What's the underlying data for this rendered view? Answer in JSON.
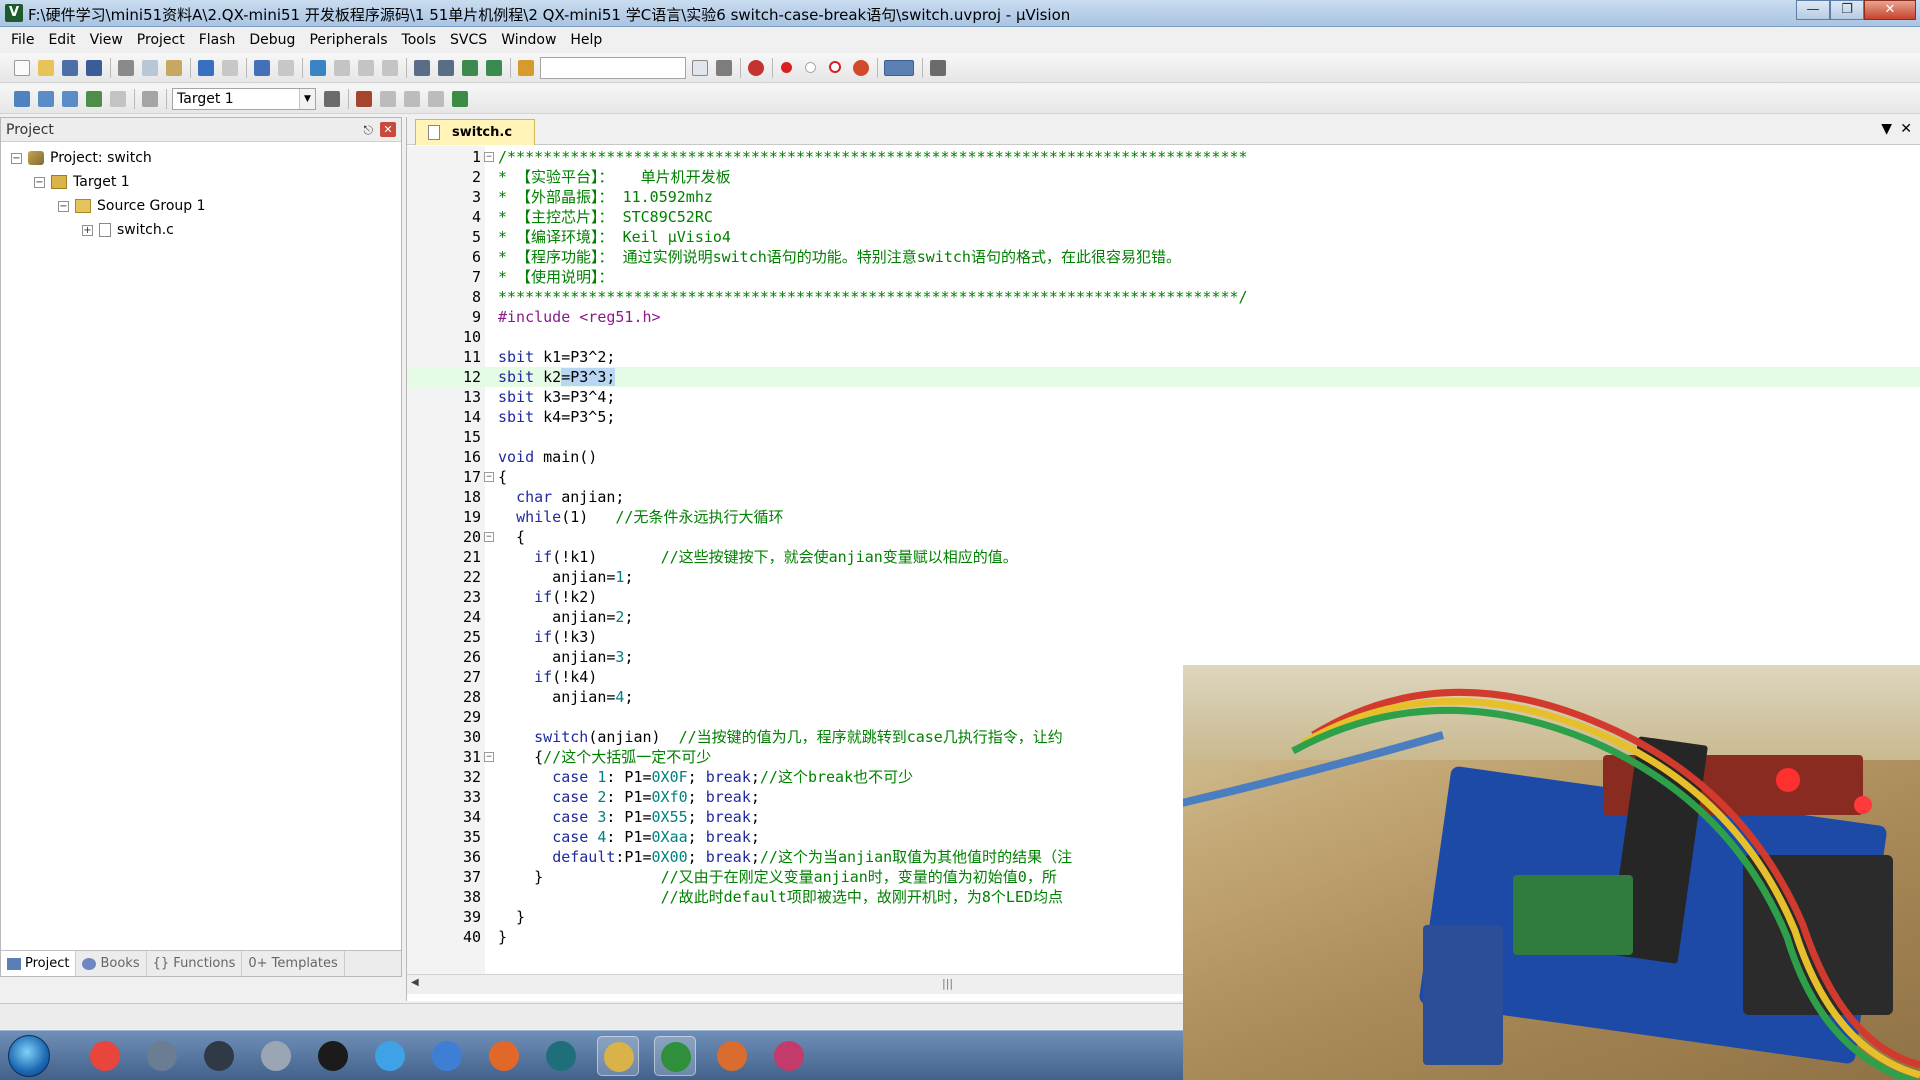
{
  "window": {
    "title": "F:\\硬件学习\\mini51资料A\\2.QX-mini51 开发板程序源码\\1 51单片机例程\\2 QX-mini51 学C语言\\实验6 switch-case-break语句\\switch.uvproj - µVision",
    "app_icon": "V"
  },
  "menu": [
    "File",
    "Edit",
    "View",
    "Project",
    "Flash",
    "Debug",
    "Peripherals",
    "Tools",
    "SVCS",
    "Window",
    "Help"
  ],
  "toolbar": {
    "target_select": "Target 1",
    "find_combo": ""
  },
  "project_panel": {
    "title": "Project",
    "tree": [
      {
        "label": "Project: switch",
        "toggle": "−"
      },
      {
        "label": "Target 1",
        "toggle": "−"
      },
      {
        "label": "Source Group 1",
        "toggle": "−"
      },
      {
        "label": "switch.c",
        "toggle": "+"
      }
    ],
    "tabs": [
      "Project",
      "Books",
      "{} Functions",
      "0+ Templates"
    ]
  },
  "editor": {
    "tab": "switch.c",
    "lines": [
      {
        "n": "1",
        "fold": "−",
        "segs": [
          {
            "t": "/**********************************************************************************",
            "c": "cmt"
          }
        ]
      },
      {
        "n": "2",
        "fold": "",
        "segs": [
          {
            "t": "* 【实验平台】：   单片机开发板",
            "c": "cmt"
          }
        ]
      },
      {
        "n": "3",
        "fold": "",
        "segs": [
          {
            "t": "* 【外部晶振】： 11.0592mhz",
            "c": "cmt"
          }
        ]
      },
      {
        "n": "4",
        "fold": "",
        "segs": [
          {
            "t": "* 【主控芯片】： STC89C52RC",
            "c": "cmt"
          }
        ]
      },
      {
        "n": "5",
        "fold": "",
        "segs": [
          {
            "t": "* 【编译环境】： Keil µVisio4",
            "c": "cmt"
          }
        ]
      },
      {
        "n": "6",
        "fold": "",
        "segs": [
          {
            "t": "* 【程序功能】： 通过实例说明switch语句的功能。特别注意switch语句的格式，在此很容易犯错。",
            "c": "cmt"
          }
        ]
      },
      {
        "n": "7",
        "fold": "",
        "segs": [
          {
            "t": "* 【使用说明】：",
            "c": "cmt"
          }
        ]
      },
      {
        "n": "8",
        "fold": "",
        "segs": [
          {
            "t": "**********************************************************************************/",
            "c": "cmt"
          }
        ]
      },
      {
        "n": "9",
        "fold": "",
        "segs": [
          {
            "t": "#include <reg51.h>",
            "c": "pp"
          }
        ]
      },
      {
        "n": "10",
        "fold": "",
        "segs": [
          {
            "t": "",
            "c": ""
          }
        ]
      },
      {
        "n": "11",
        "fold": "",
        "segs": [
          {
            "t": "sbit",
            "c": "kw"
          },
          {
            "t": " k1=P3^2;",
            "c": ""
          }
        ]
      },
      {
        "n": "12",
        "fold": "",
        "hl": true,
        "segs": [
          {
            "t": "sbit",
            "c": "kw"
          },
          {
            "t": " k2",
            "c": ""
          },
          {
            "t": "=P3^3;",
            "c": "sel"
          }
        ]
      },
      {
        "n": "13",
        "fold": "",
        "segs": [
          {
            "t": "sbit",
            "c": "kw"
          },
          {
            "t": " k3=P3^4;",
            "c": ""
          }
        ]
      },
      {
        "n": "14",
        "fold": "",
        "segs": [
          {
            "t": "sbit",
            "c": "kw"
          },
          {
            "t": " k4=P3^5;",
            "c": ""
          }
        ]
      },
      {
        "n": "15",
        "fold": "",
        "segs": [
          {
            "t": "",
            "c": ""
          }
        ]
      },
      {
        "n": "16",
        "fold": "",
        "segs": [
          {
            "t": "void",
            "c": "kw"
          },
          {
            "t": " main()",
            "c": ""
          }
        ]
      },
      {
        "n": "17",
        "fold": "−",
        "segs": [
          {
            "t": "{",
            "c": ""
          }
        ]
      },
      {
        "n": "18",
        "fold": "",
        "segs": [
          {
            "t": "  ",
            "c": ""
          },
          {
            "t": "char",
            "c": "kw"
          },
          {
            "t": " anjian;",
            "c": ""
          }
        ]
      },
      {
        "n": "19",
        "fold": "",
        "segs": [
          {
            "t": "  ",
            "c": ""
          },
          {
            "t": "while",
            "c": "kw"
          },
          {
            "t": "(1)   ",
            "c": ""
          },
          {
            "t": "//无条件永远执行大循环",
            "c": "cmt"
          }
        ]
      },
      {
        "n": "20",
        "fold": "−",
        "segs": [
          {
            "t": "  {",
            "c": ""
          }
        ]
      },
      {
        "n": "21",
        "fold": "",
        "segs": [
          {
            "t": "    ",
            "c": ""
          },
          {
            "t": "if",
            "c": "kw"
          },
          {
            "t": "(!k1)       ",
            "c": ""
          },
          {
            "t": "//这些按键按下，就会使anjian变量赋以相应的值。",
            "c": "cmt"
          }
        ]
      },
      {
        "n": "22",
        "fold": "",
        "segs": [
          {
            "t": "      anjian=",
            "c": ""
          },
          {
            "t": "1",
            "c": "num"
          },
          {
            "t": ";",
            "c": ""
          }
        ]
      },
      {
        "n": "23",
        "fold": "",
        "segs": [
          {
            "t": "    ",
            "c": ""
          },
          {
            "t": "if",
            "c": "kw"
          },
          {
            "t": "(!k2)",
            "c": ""
          }
        ]
      },
      {
        "n": "24",
        "fold": "",
        "segs": [
          {
            "t": "      anjian=",
            "c": ""
          },
          {
            "t": "2",
            "c": "num"
          },
          {
            "t": ";",
            "c": ""
          }
        ]
      },
      {
        "n": "25",
        "fold": "",
        "segs": [
          {
            "t": "    ",
            "c": ""
          },
          {
            "t": "if",
            "c": "kw"
          },
          {
            "t": "(!k3)",
            "c": ""
          }
        ]
      },
      {
        "n": "26",
        "fold": "",
        "segs": [
          {
            "t": "      anjian=",
            "c": ""
          },
          {
            "t": "3",
            "c": "num"
          },
          {
            "t": ";",
            "c": ""
          }
        ]
      },
      {
        "n": "27",
        "fold": "",
        "segs": [
          {
            "t": "    ",
            "c": ""
          },
          {
            "t": "if",
            "c": "kw"
          },
          {
            "t": "(!k4)",
            "c": ""
          }
        ]
      },
      {
        "n": "28",
        "fold": "",
        "segs": [
          {
            "t": "      anjian=",
            "c": ""
          },
          {
            "t": "4",
            "c": "num"
          },
          {
            "t": ";",
            "c": ""
          }
        ]
      },
      {
        "n": "29",
        "fold": "",
        "segs": [
          {
            "t": "",
            "c": ""
          }
        ]
      },
      {
        "n": "30",
        "fold": "",
        "segs": [
          {
            "t": "    ",
            "c": ""
          },
          {
            "t": "switch",
            "c": "kw"
          },
          {
            "t": "(anjian)  ",
            "c": ""
          },
          {
            "t": "//当按键的值为几，程序就跳转到case几执行指令，让约",
            "c": "cmt"
          }
        ]
      },
      {
        "n": "31",
        "fold": "−",
        "segs": [
          {
            "t": "    {",
            "c": ""
          },
          {
            "t": "//这个大括弧一定不可少",
            "c": "cmt"
          }
        ]
      },
      {
        "n": "32",
        "fold": "",
        "segs": [
          {
            "t": "      ",
            "c": ""
          },
          {
            "t": "case",
            "c": "kw"
          },
          {
            "t": " ",
            "c": ""
          },
          {
            "t": "1",
            "c": "num"
          },
          {
            "t": ": P1=",
            "c": ""
          },
          {
            "t": "0X0F",
            "c": "num"
          },
          {
            "t": "; ",
            "c": ""
          },
          {
            "t": "break",
            "c": "kw"
          },
          {
            "t": ";",
            "c": ""
          },
          {
            "t": "//这个break也不可少",
            "c": "cmt"
          }
        ]
      },
      {
        "n": "33",
        "fold": "",
        "segs": [
          {
            "t": "      ",
            "c": ""
          },
          {
            "t": "case",
            "c": "kw"
          },
          {
            "t": " ",
            "c": ""
          },
          {
            "t": "2",
            "c": "num"
          },
          {
            "t": ": P1=",
            "c": ""
          },
          {
            "t": "0Xf0",
            "c": "num"
          },
          {
            "t": "; ",
            "c": ""
          },
          {
            "t": "break",
            "c": "kw"
          },
          {
            "t": ";",
            "c": ""
          }
        ]
      },
      {
        "n": "34",
        "fold": "",
        "segs": [
          {
            "t": "      ",
            "c": ""
          },
          {
            "t": "case",
            "c": "kw"
          },
          {
            "t": " ",
            "c": ""
          },
          {
            "t": "3",
            "c": "num"
          },
          {
            "t": ": P1=",
            "c": ""
          },
          {
            "t": "0X55",
            "c": "num"
          },
          {
            "t": "; ",
            "c": ""
          },
          {
            "t": "break",
            "c": "kw"
          },
          {
            "t": ";",
            "c": ""
          }
        ]
      },
      {
        "n": "35",
        "fold": "",
        "segs": [
          {
            "t": "      ",
            "c": ""
          },
          {
            "t": "case",
            "c": "kw"
          },
          {
            "t": " ",
            "c": ""
          },
          {
            "t": "4",
            "c": "num"
          },
          {
            "t": ": P1=",
            "c": ""
          },
          {
            "t": "0Xaa",
            "c": "num"
          },
          {
            "t": "; ",
            "c": ""
          },
          {
            "t": "break",
            "c": "kw"
          },
          {
            "t": ";",
            "c": ""
          }
        ]
      },
      {
        "n": "36",
        "fold": "",
        "segs": [
          {
            "t": "      ",
            "c": ""
          },
          {
            "t": "default",
            "c": "kw"
          },
          {
            "t": ":P1=",
            "c": ""
          },
          {
            "t": "0X00",
            "c": "num"
          },
          {
            "t": "; ",
            "c": ""
          },
          {
            "t": "break",
            "c": "kw"
          },
          {
            "t": ";",
            "c": ""
          },
          {
            "t": "//这个为当anjian取值为其他值时的结果（注",
            "c": "cmt"
          }
        ]
      },
      {
        "n": "37",
        "fold": "",
        "segs": [
          {
            "t": "    }             ",
            "c": ""
          },
          {
            "t": "//又由于在刚定义变量anjian时，变量的值为初始值0，所",
            "c": "cmt"
          }
        ]
      },
      {
        "n": "38",
        "fold": "",
        "segs": [
          {
            "t": "                  ",
            "c": ""
          },
          {
            "t": "//故此时default项即被选中，故刚开机时，为8个LED均点",
            "c": "cmt"
          }
        ]
      },
      {
        "n": "39",
        "fold": "",
        "segs": [
          {
            "t": "  }",
            "c": ""
          }
        ]
      },
      {
        "n": "40",
        "fold": "",
        "segs": [
          {
            "t": "}",
            "c": ""
          }
        ]
      }
    ]
  },
  "colors": {
    "titlebar": "#b7cde6",
    "highlight_line": "#e6fbe6",
    "selection": "#b9d6f2",
    "comment": "#008000",
    "keyword": "#1f2a9c",
    "number": "#008080"
  },
  "taskbar_icons": [
    "chrome-icon",
    "clapper-icon",
    "video-icon",
    "camera-icon",
    "g-app-icon",
    "flower-app-icon",
    "bird-app-icon",
    "pdf-icon",
    "download-app-icon",
    "folder-icon",
    "keil-icon",
    "fox-app-icon",
    "rainbow-app-icon"
  ]
}
